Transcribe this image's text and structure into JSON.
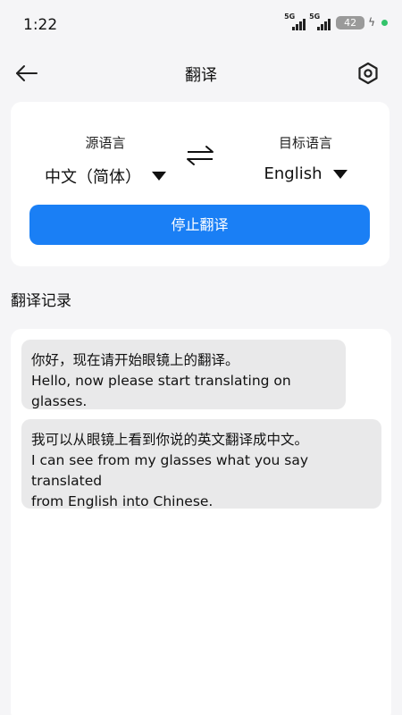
{
  "status_bar": {
    "time": "1:22",
    "signal_1_label": "5G",
    "signal_2_label": "5G",
    "battery_level": "42",
    "charging_icon": "bolt-icon",
    "indicator_color": "#33c36b"
  },
  "header": {
    "back_icon": "arrow-left-icon",
    "title": "翻译",
    "settings_icon": "hexagon-settings-icon"
  },
  "language_panel": {
    "source_label": "源语言",
    "source_value": "中文（简体）",
    "target_label": "目标语言",
    "target_value": "English",
    "swap_icon": "swap-arrows-icon",
    "stop_button_label": "停止翻译",
    "accent_color": "#1a7ff5"
  },
  "history": {
    "title": "翻译记录",
    "entries": [
      {
        "source": "你好，现在请开始眼镜上的翻译。",
        "translation": "Hello, now please start translating on glasses."
      },
      {
        "source": "我可以从眼镜上看到你说的英文翻译成中文。",
        "translation": "I can see from my glasses what you say translated\nfrom English into Chinese."
      }
    ]
  }
}
